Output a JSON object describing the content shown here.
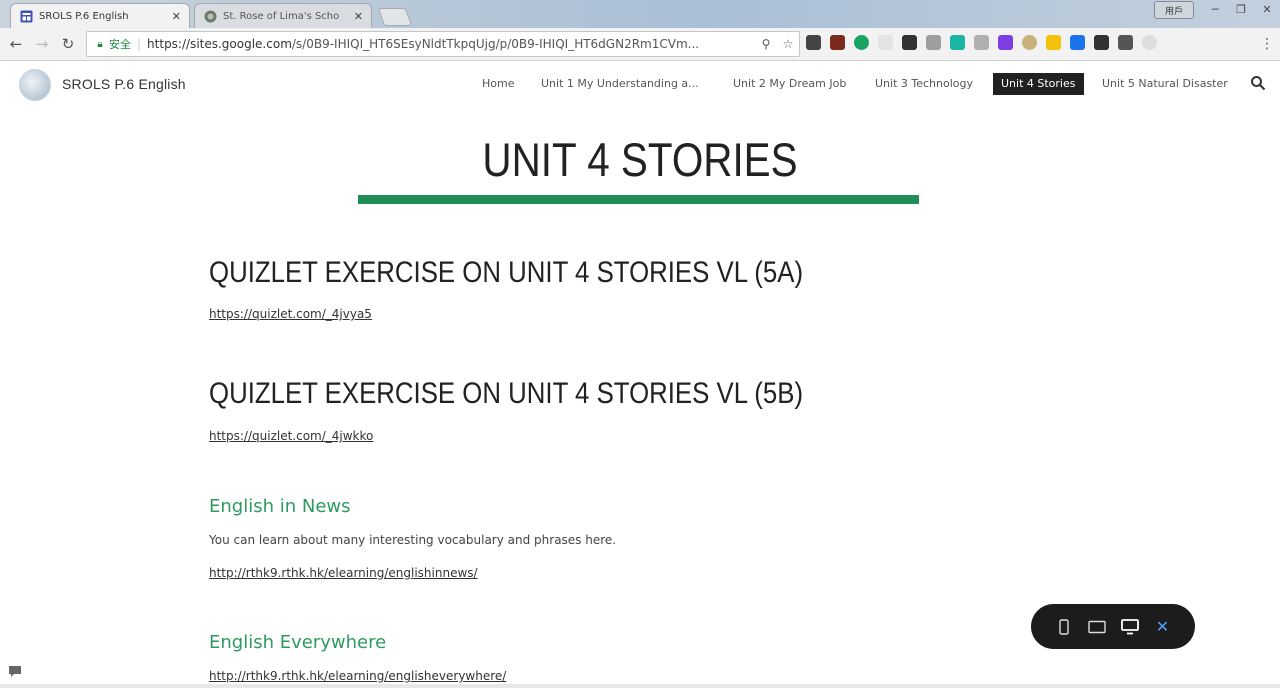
{
  "browser": {
    "tabs": [
      {
        "title": "SROLS P.6 English",
        "active": true
      },
      {
        "title": "St. Rose of Lima's Scho",
        "active": false
      }
    ],
    "profile_label": "用戶",
    "omnibox": {
      "secure_label": "安全",
      "url_host": "https://sites.google.com",
      "url_path": "/s/0B9-IHIQI_HT6SEsyNldtTkpqUjg/p/0B9-IHIQI_HT6dGN2Rm1CVm..."
    }
  },
  "site": {
    "name": "SROLS P.6 English",
    "nav": [
      {
        "label": "Home",
        "active": false
      },
      {
        "label": "Unit 1 My Understanding a...",
        "active": false
      },
      {
        "label": "Unit 2 My Dream Job",
        "active": false
      },
      {
        "label": "Unit 3 Technology",
        "active": false
      },
      {
        "label": "Unit 4 Stories",
        "active": true
      },
      {
        "label": "Unit 5 Natural Disaster",
        "active": false
      }
    ]
  },
  "page": {
    "title": "UNIT 4 STORIES",
    "accent_color": "#1e8e56",
    "sections": [
      {
        "heading": "QUIZLET EXERCISE ON UNIT 4 STORIES VL (5A)",
        "link": "https://quizlet.com/_4jvya5"
      },
      {
        "heading": "QUIZLET EXERCISE ON UNIT 4 STORIES VL (5B)",
        "link": "https://quizlet.com/_4jwkko"
      },
      {
        "heading": "English in News",
        "text": "You can learn about many interesting vocabulary and phrases here.",
        "link": "http://rthk9.rthk.hk/elearning/englishinnews/"
      },
      {
        "heading": "English Everywhere",
        "link": "http://rthk9.rthk.hk/elearning/englisheverywhere/"
      }
    ]
  },
  "preview_bar": {
    "icons": [
      "phone-icon",
      "tablet-icon",
      "desktop-icon",
      "close-icon"
    ]
  }
}
